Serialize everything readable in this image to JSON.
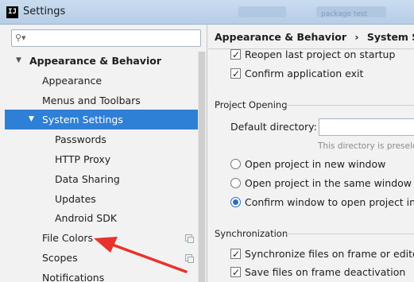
{
  "window": {
    "title": "Settings",
    "app_icon": "IJ",
    "bg_tab_text": "package test"
  },
  "search": {
    "placeholder": "",
    "icon": "search-icon"
  },
  "tree": [
    {
      "label": "Appearance & Behavior",
      "level": 0,
      "expanded": true,
      "bold": true
    },
    {
      "label": "Appearance",
      "level": 1
    },
    {
      "label": "Menus and Toolbars",
      "level": 1
    },
    {
      "label": "System Settings",
      "level": 1,
      "expanded": true,
      "selected": true
    },
    {
      "label": "Passwords",
      "level": 2
    },
    {
      "label": "HTTP Proxy",
      "level": 2
    },
    {
      "label": "Data Sharing",
      "level": 2
    },
    {
      "label": "Updates",
      "level": 2
    },
    {
      "label": "Android SDK",
      "level": 2
    },
    {
      "label": "File Colors",
      "level": 1,
      "copy_icon": true
    },
    {
      "label": "Scopes",
      "level": 1,
      "copy_icon": true
    },
    {
      "label": "Notifications",
      "level": 1
    }
  ],
  "breadcrumb": {
    "parent": "Appearance & Behavior",
    "separator": "›",
    "current": "System Settings"
  },
  "startup": {
    "reopen_last_project": {
      "label": "Reopen last project on startup",
      "checked": true
    },
    "confirm_exit": {
      "label": "Confirm application exit",
      "checked": true
    }
  },
  "project_opening": {
    "title": "Project Opening",
    "default_directory_label": "Default directory:",
    "default_directory_value": "",
    "hint": "This directory is preselected in 'Open...' and 'New | Project...' dialogs.",
    "options": [
      {
        "label": "Open project in new window",
        "selected": false
      },
      {
        "label": "Open project in the same window",
        "selected": false
      },
      {
        "label": "Confirm window to open project in",
        "selected": true
      }
    ]
  },
  "synchronization": {
    "title": "Synchronization",
    "sync_files": {
      "label": "Synchronize files on frame or editor tab activation",
      "checked": true
    },
    "save_files": {
      "label": "Save files on frame deactivation",
      "checked": true
    }
  },
  "colors": {
    "selection": "#2d80d5",
    "annotation_arrow": "#e8322b"
  }
}
